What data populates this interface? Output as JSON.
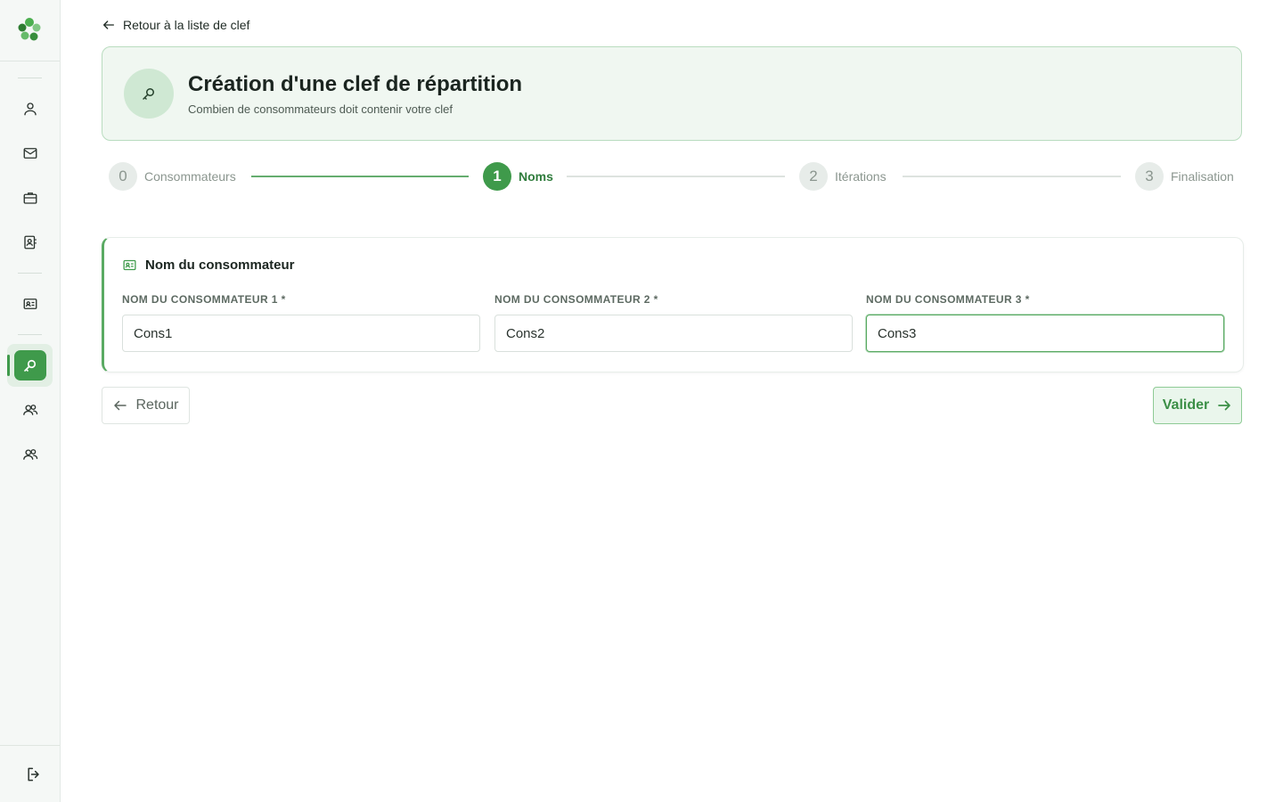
{
  "sidebar": {
    "items": [
      {
        "icon": "user-icon"
      },
      {
        "icon": "mail-icon"
      },
      {
        "icon": "briefcase-icon"
      },
      {
        "icon": "contact-book-icon"
      },
      {
        "icon": "id-card-icon"
      },
      {
        "icon": "key-search-icon",
        "active": true
      },
      {
        "icon": "users-icon"
      },
      {
        "icon": "users-icon"
      }
    ],
    "logout_icon": "logout-icon",
    "accent": "#3f9a4b"
  },
  "back_link": "Retour à la liste de clef",
  "header": {
    "title": "Création d'une clef de répartition",
    "subtitle": "Combien de consommateurs doit contenir votre clef"
  },
  "stepper": {
    "steps": [
      {
        "number": "0",
        "label": "Consommateurs",
        "state": "done"
      },
      {
        "number": "1",
        "label": "Noms",
        "state": "active"
      },
      {
        "number": "2",
        "label": "Itérations",
        "state": "todo"
      },
      {
        "number": "3",
        "label": "Finalisation",
        "state": "todo"
      }
    ]
  },
  "form": {
    "title": "Nom du consommateur",
    "fields": [
      {
        "label": "NOM DU CONSOMMATEUR 1 *",
        "value": "Cons1"
      },
      {
        "label": "NOM DU CONSOMMATEUR 2 *",
        "value": "Cons2"
      },
      {
        "label": "NOM DU CONSOMMATEUR 3 *",
        "value": "Cons3"
      }
    ]
  },
  "buttons": {
    "back": "Retour",
    "next": "Valider"
  }
}
